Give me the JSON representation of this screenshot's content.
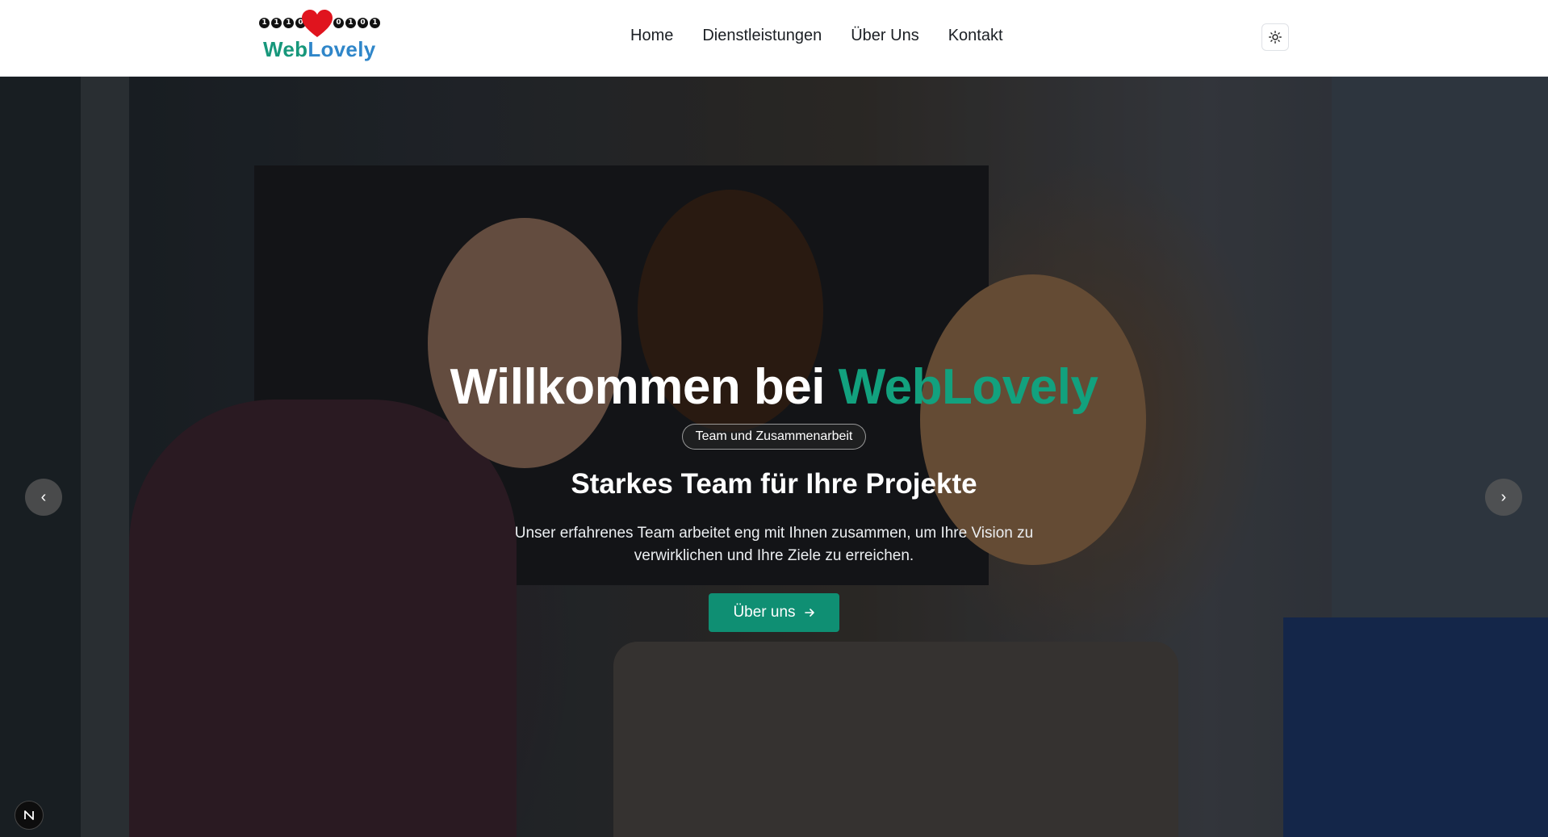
{
  "brand": {
    "bits_left": [
      "1",
      "1",
      "1",
      "0"
    ],
    "bits_right": [
      "0",
      "1",
      "0",
      "1"
    ],
    "name_part1": "Web",
    "name_part2": "Lovely",
    "heart_color": "#e0141e"
  },
  "nav": {
    "items": [
      {
        "label": "Home"
      },
      {
        "label": "Dienstleistungen"
      },
      {
        "label": "Über Uns"
      },
      {
        "label": "Kontakt"
      }
    ]
  },
  "theme_toggle": {
    "icon": "sun-icon"
  },
  "hero": {
    "title_prefix": "Willkommen bei ",
    "title_accent": "WebLovely",
    "badge": "Team und Zusammenarbeit",
    "subtitle": "Starkes Team für Ihre Projekte",
    "description": "Unser erfahrenes Team arbeitet eng mit Ihnen zusammen, um Ihre Vision zu verwirklichen und Ihre Ziele zu erreichen.",
    "cta_label": "Über uns",
    "prev_icon": "‹",
    "next_icon": "›",
    "accent_color": "#12a17e"
  },
  "dev_badge": {
    "letter": "N"
  }
}
